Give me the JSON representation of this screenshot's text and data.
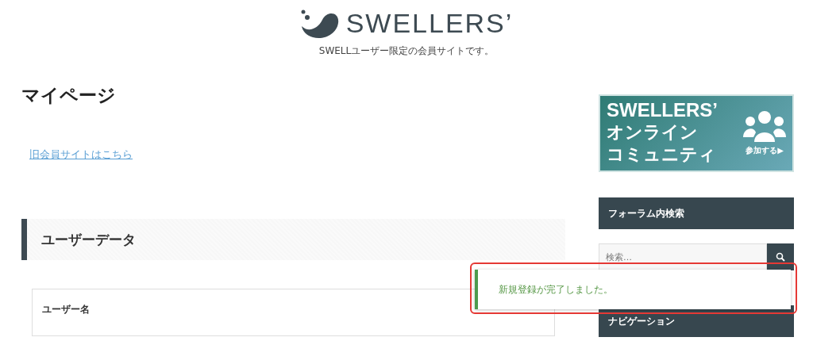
{
  "header": {
    "logo_text": "SWELLERS’",
    "tagline": "SWELLユーザー限定の会員サイトです。"
  },
  "main": {
    "page_title": "マイページ",
    "old_site_link": "旧会員サイトはこちら",
    "section_heading": "ユーザーデータ",
    "card_label": "ユーザー名"
  },
  "sidebar": {
    "banner": {
      "title": "SWELLERS’",
      "line_2": "オンライン",
      "line_3": "コミュニティ",
      "cta": "参加する▶"
    },
    "search_heading": "フォーラム内検索",
    "search": {
      "placeholder": "検索…"
    },
    "nav_heading": "ナビゲーション"
  },
  "notice": {
    "message": "新規登録が完了しました。"
  }
}
